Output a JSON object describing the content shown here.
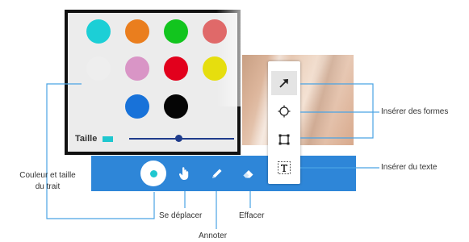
{
  "palette": {
    "colors": [
      "#1ccfd6",
      "#ea7e1e",
      "#12c51e",
      "#e06969",
      "#eeeeee",
      "#d995c6",
      "#e2001c",
      "#e6de0e",
      "#1872d9",
      "#050505"
    ],
    "size_label": "Taille",
    "size_color": "#1fc7cf",
    "stroke_size_fraction": 0.47
  },
  "toolbar": {
    "color": "#2e86d8",
    "tools": [
      {
        "name": "color-stroke",
        "icon": "dot-icon",
        "active": true
      },
      {
        "name": "move",
        "icon": "hand-icon"
      },
      {
        "name": "annotate",
        "icon": "pencil-icon"
      },
      {
        "name": "erase",
        "icon": "eraser-icon"
      }
    ]
  },
  "shapes_panel": {
    "tools": [
      {
        "name": "arrow",
        "icon": "arrow-icon",
        "selected": true
      },
      {
        "name": "circle",
        "icon": "circle-icon"
      },
      {
        "name": "rectangle",
        "icon": "square-icon"
      },
      {
        "name": "text",
        "icon": "text-icon"
      }
    ]
  },
  "callouts": {
    "color_size_line1": "Couleur et taille",
    "color_size_line2": "du trait",
    "move": "Se déplacer",
    "annotate": "Annoter",
    "erase": "Effacer",
    "insert_shapes": "Insérer des formes",
    "insert_text": "Insérer du texte"
  },
  "line_color": "#4aa3e4"
}
